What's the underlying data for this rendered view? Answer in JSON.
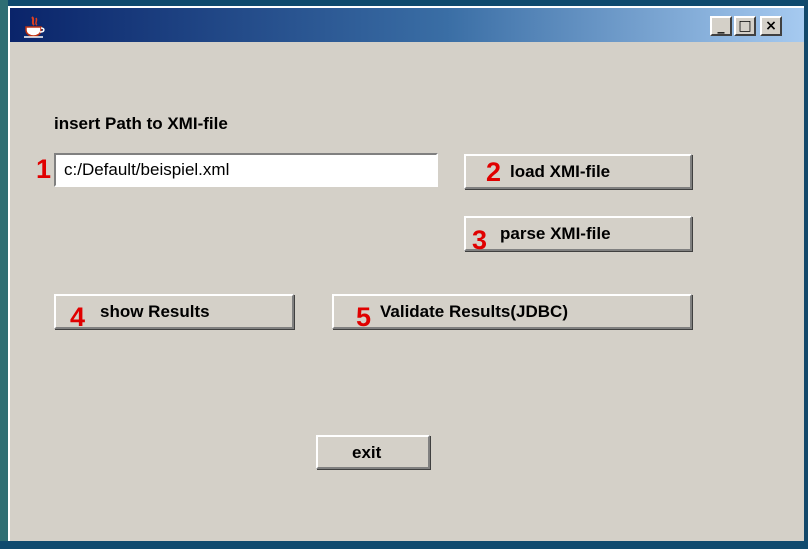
{
  "window": {
    "app_icon": "java-cup-icon",
    "controls": {
      "minimize": "_",
      "maximize": "□",
      "close": "×"
    }
  },
  "form": {
    "path_label": "insert Path to XMI-file",
    "path_value": "c:/Default/beispiel.xml"
  },
  "buttons": {
    "load": "load XMI-file",
    "parse": "parse XMI-file",
    "show": "show Results",
    "validate": "Validate Results(JDBC)",
    "exit": "exit"
  },
  "annotations": {
    "n1": "1",
    "n2": "2",
    "n3": "3",
    "n4": "4",
    "n5": "5",
    "color": "#e00000"
  }
}
